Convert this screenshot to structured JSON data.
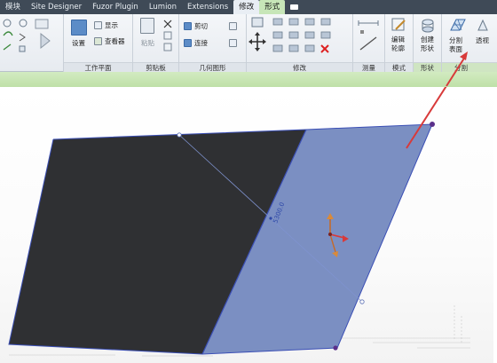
{
  "tabs": [
    {
      "label": "模块",
      "active": false
    },
    {
      "label": "Site Designer",
      "active": false
    },
    {
      "label": "Fuzor Plugin",
      "active": false
    },
    {
      "label": "Lumion",
      "active": false
    },
    {
      "label": "Extensions",
      "active": false
    },
    {
      "label": "修改",
      "active": true
    },
    {
      "label": "形式",
      "active": true
    }
  ],
  "ribbon": {
    "workplane": {
      "label": "工作平面",
      "set": "设置",
      "show": "显示",
      "viewer": "查看器"
    },
    "clipboard": {
      "label": "剪贴板",
      "paste": "粘贴"
    },
    "geometry": {
      "label": "几何图形",
      "cut": "剪切",
      "join": "连接"
    },
    "modify": {
      "label": "修改"
    },
    "measure": {
      "label": "测量"
    },
    "mode": {
      "label": "模式",
      "edit_profile": "编辑\n轮廓",
      "edit_profile_l1": "编辑",
      "edit_profile_l2": "轮廓"
    },
    "form": {
      "label": "形状",
      "create_form_l1": "创建",
      "create_form_l2": "形状"
    },
    "divide": {
      "label": "分割",
      "divide_surface_l1": "分割",
      "divide_surface_l2": "表面",
      "transparent": "透视"
    }
  },
  "viewport": {
    "dimension_text": "5300.0"
  },
  "colors": {
    "tabbar": "#3f4a57",
    "dark_face": "#2f3033",
    "blue_face": "#7b8fc2",
    "edge": "#3b4fb5",
    "arrow": "#d83a3a",
    "point": "#5a2f8a"
  }
}
